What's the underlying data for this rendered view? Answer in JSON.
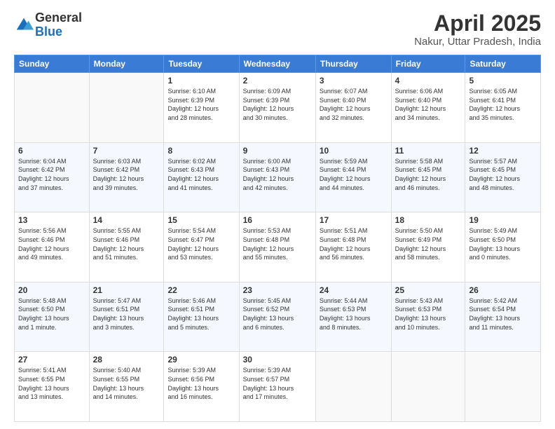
{
  "header": {
    "logo_general": "General",
    "logo_blue": "Blue",
    "month_title": "April 2025",
    "location": "Nakur, Uttar Pradesh, India"
  },
  "days_of_week": [
    "Sunday",
    "Monday",
    "Tuesday",
    "Wednesday",
    "Thursday",
    "Friday",
    "Saturday"
  ],
  "weeks": [
    [
      {
        "day": "",
        "info": ""
      },
      {
        "day": "",
        "info": ""
      },
      {
        "day": "1",
        "info": "Sunrise: 6:10 AM\nSunset: 6:39 PM\nDaylight: 12 hours\nand 28 minutes."
      },
      {
        "day": "2",
        "info": "Sunrise: 6:09 AM\nSunset: 6:39 PM\nDaylight: 12 hours\nand 30 minutes."
      },
      {
        "day": "3",
        "info": "Sunrise: 6:07 AM\nSunset: 6:40 PM\nDaylight: 12 hours\nand 32 minutes."
      },
      {
        "day": "4",
        "info": "Sunrise: 6:06 AM\nSunset: 6:40 PM\nDaylight: 12 hours\nand 34 minutes."
      },
      {
        "day": "5",
        "info": "Sunrise: 6:05 AM\nSunset: 6:41 PM\nDaylight: 12 hours\nand 35 minutes."
      }
    ],
    [
      {
        "day": "6",
        "info": "Sunrise: 6:04 AM\nSunset: 6:42 PM\nDaylight: 12 hours\nand 37 minutes."
      },
      {
        "day": "7",
        "info": "Sunrise: 6:03 AM\nSunset: 6:42 PM\nDaylight: 12 hours\nand 39 minutes."
      },
      {
        "day": "8",
        "info": "Sunrise: 6:02 AM\nSunset: 6:43 PM\nDaylight: 12 hours\nand 41 minutes."
      },
      {
        "day": "9",
        "info": "Sunrise: 6:00 AM\nSunset: 6:43 PM\nDaylight: 12 hours\nand 42 minutes."
      },
      {
        "day": "10",
        "info": "Sunrise: 5:59 AM\nSunset: 6:44 PM\nDaylight: 12 hours\nand 44 minutes."
      },
      {
        "day": "11",
        "info": "Sunrise: 5:58 AM\nSunset: 6:45 PM\nDaylight: 12 hours\nand 46 minutes."
      },
      {
        "day": "12",
        "info": "Sunrise: 5:57 AM\nSunset: 6:45 PM\nDaylight: 12 hours\nand 48 minutes."
      }
    ],
    [
      {
        "day": "13",
        "info": "Sunrise: 5:56 AM\nSunset: 6:46 PM\nDaylight: 12 hours\nand 49 minutes."
      },
      {
        "day": "14",
        "info": "Sunrise: 5:55 AM\nSunset: 6:46 PM\nDaylight: 12 hours\nand 51 minutes."
      },
      {
        "day": "15",
        "info": "Sunrise: 5:54 AM\nSunset: 6:47 PM\nDaylight: 12 hours\nand 53 minutes."
      },
      {
        "day": "16",
        "info": "Sunrise: 5:53 AM\nSunset: 6:48 PM\nDaylight: 12 hours\nand 55 minutes."
      },
      {
        "day": "17",
        "info": "Sunrise: 5:51 AM\nSunset: 6:48 PM\nDaylight: 12 hours\nand 56 minutes."
      },
      {
        "day": "18",
        "info": "Sunrise: 5:50 AM\nSunset: 6:49 PM\nDaylight: 12 hours\nand 58 minutes."
      },
      {
        "day": "19",
        "info": "Sunrise: 5:49 AM\nSunset: 6:50 PM\nDaylight: 13 hours\nand 0 minutes."
      }
    ],
    [
      {
        "day": "20",
        "info": "Sunrise: 5:48 AM\nSunset: 6:50 PM\nDaylight: 13 hours\nand 1 minute."
      },
      {
        "day": "21",
        "info": "Sunrise: 5:47 AM\nSunset: 6:51 PM\nDaylight: 13 hours\nand 3 minutes."
      },
      {
        "day": "22",
        "info": "Sunrise: 5:46 AM\nSunset: 6:51 PM\nDaylight: 13 hours\nand 5 minutes."
      },
      {
        "day": "23",
        "info": "Sunrise: 5:45 AM\nSunset: 6:52 PM\nDaylight: 13 hours\nand 6 minutes."
      },
      {
        "day": "24",
        "info": "Sunrise: 5:44 AM\nSunset: 6:53 PM\nDaylight: 13 hours\nand 8 minutes."
      },
      {
        "day": "25",
        "info": "Sunrise: 5:43 AM\nSunset: 6:53 PM\nDaylight: 13 hours\nand 10 minutes."
      },
      {
        "day": "26",
        "info": "Sunrise: 5:42 AM\nSunset: 6:54 PM\nDaylight: 13 hours\nand 11 minutes."
      }
    ],
    [
      {
        "day": "27",
        "info": "Sunrise: 5:41 AM\nSunset: 6:55 PM\nDaylight: 13 hours\nand 13 minutes."
      },
      {
        "day": "28",
        "info": "Sunrise: 5:40 AM\nSunset: 6:55 PM\nDaylight: 13 hours\nand 14 minutes."
      },
      {
        "day": "29",
        "info": "Sunrise: 5:39 AM\nSunset: 6:56 PM\nDaylight: 13 hours\nand 16 minutes."
      },
      {
        "day": "30",
        "info": "Sunrise: 5:39 AM\nSunset: 6:57 PM\nDaylight: 13 hours\nand 17 minutes."
      },
      {
        "day": "",
        "info": ""
      },
      {
        "day": "",
        "info": ""
      },
      {
        "day": "",
        "info": ""
      }
    ]
  ]
}
